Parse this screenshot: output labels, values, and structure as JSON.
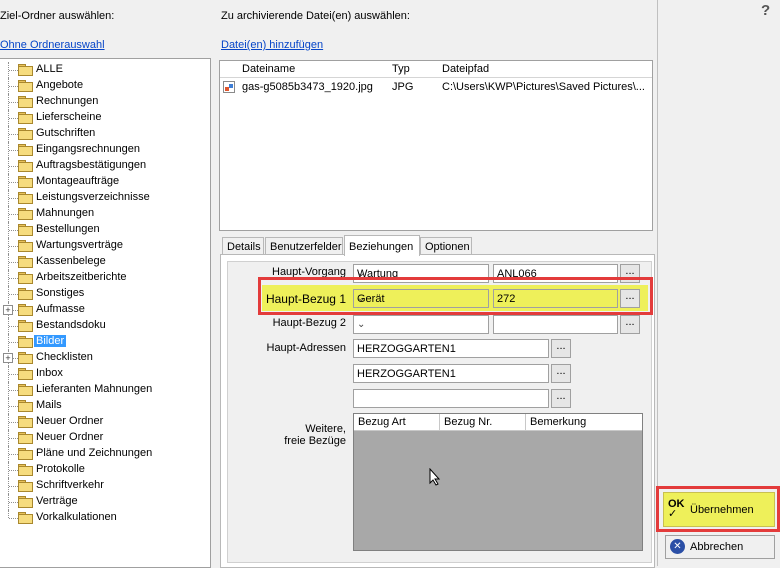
{
  "left_panel": {
    "title": "Ziel-Ordner auswählen:",
    "link": "Ohne Ordnerauswahl",
    "tree": [
      {
        "label": "ALLE"
      },
      {
        "label": "Angebote"
      },
      {
        "label": "Rechnungen"
      },
      {
        "label": "Lieferscheine"
      },
      {
        "label": "Gutschriften"
      },
      {
        "label": "Eingangsrechnungen"
      },
      {
        "label": "Auftragsbestätigungen"
      },
      {
        "label": "Montageaufträge"
      },
      {
        "label": "Leistungsverzeichnisse"
      },
      {
        "label": "Mahnungen"
      },
      {
        "label": "Bestellungen"
      },
      {
        "label": "Wartungsverträge"
      },
      {
        "label": "Kassenbelege"
      },
      {
        "label": "Arbeitszeitberichte"
      },
      {
        "label": "Sonstiges"
      },
      {
        "label": "Aufmasse",
        "expandable": true
      },
      {
        "label": "Bestandsdoku"
      },
      {
        "label": "Bilder",
        "selected": true
      },
      {
        "label": "Checklisten",
        "expandable": true
      },
      {
        "label": "Inbox"
      },
      {
        "label": "Lieferanten Mahnungen"
      },
      {
        "label": "Mails"
      },
      {
        "label": "Neuer Ordner"
      },
      {
        "label": "Neuer Ordner"
      },
      {
        "label": "Pläne und Zeichnungen"
      },
      {
        "label": "Protokolle"
      },
      {
        "label": "Schriftverkehr"
      },
      {
        "label": "Verträge"
      },
      {
        "label": "Vorkalkulationen"
      }
    ]
  },
  "files": {
    "title": "Zu archivierende Datei(en) auswählen:",
    "add_link": "Datei(en) hinzufügen",
    "columns": [
      "Dateiname",
      "Typ",
      "Dateipfad"
    ],
    "rows": [
      {
        "name": "gas-g5085b3473_1920.jpg",
        "type": "JPG",
        "path": "C:\\Users\\KWP\\Pictures\\Saved Pictures\\..."
      }
    ]
  },
  "tabs": [
    "Details",
    "Benutzerfelder",
    "Beziehungen",
    "Optionen"
  ],
  "active_tab": "Beziehungen",
  "relations": {
    "haupt_vorgang_label": "Haupt-Vorgang",
    "haupt_vorgang_type": "Wartung",
    "haupt_vorgang_value": "ANL066",
    "haupt_bezug1_label": "Haupt-Bezug 1",
    "haupt_bezug1_type": "Gerät",
    "haupt_bezug1_value": "272",
    "haupt_bezug2_label": "Haupt-Bezug 2",
    "haupt_bezug2_type": "",
    "haupt_bezug2_value": "",
    "haupt_adressen_label": "Haupt-Adressen",
    "addresses": [
      "HERZOGGARTEN1",
      "HERZOGGARTEN1",
      ""
    ],
    "weitere_label_1": "Weitere,",
    "weitere_label_2": "freie Bezüge",
    "table_columns": [
      "Bezug Art",
      "Bezug Nr.",
      "Bemerkung"
    ],
    "dots": "..."
  },
  "right_panel": {
    "help": "?",
    "ok_label": "Übernehmen",
    "cancel_label": "Abbrechen"
  },
  "colors": {
    "highlight_yellow": "#eef05a",
    "highlight_red": "#e33b3b",
    "selection_blue": "#3399ff",
    "link_blue": "#0645c8"
  }
}
